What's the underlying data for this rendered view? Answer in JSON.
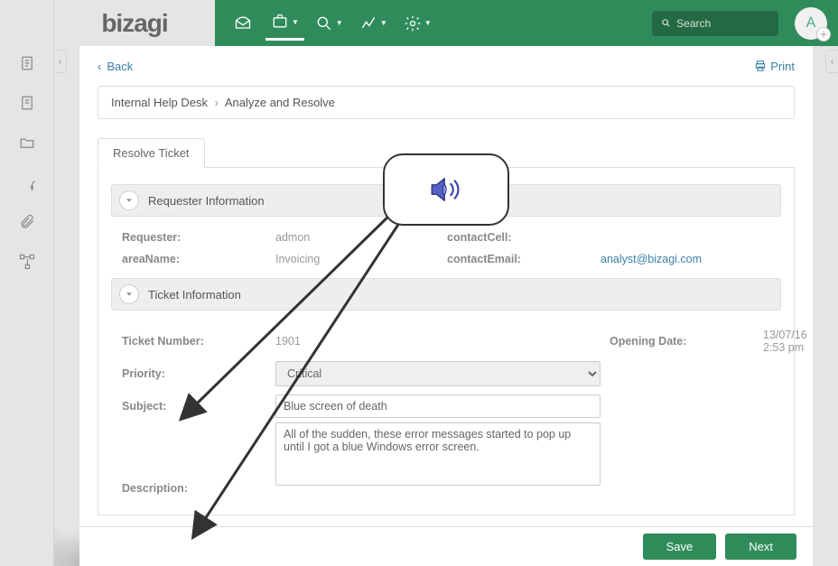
{
  "brand": "bizagi",
  "avatar_initial": "A",
  "search": {
    "placeholder": "Search"
  },
  "subhead": {
    "back": "Back",
    "print": "Print"
  },
  "breadcrumb": {
    "root": "Internal Help Desk",
    "current": "Analyze and Resolve"
  },
  "tab_label": "Resolve Ticket",
  "sections": {
    "requester": {
      "title": "Requester Information",
      "fields": {
        "requester_label": "Requester:",
        "requester_value": "admon",
        "area_label": "areaName:",
        "area_value": "Invoicing",
        "cell_label": "contactCell:",
        "cell_value": "",
        "email_label": "contactEmail:",
        "email_value": "analyst@bizagi.com"
      }
    },
    "ticket": {
      "title": "Ticket Information",
      "fields": {
        "number_label": "Ticket Number:",
        "number_value": "1901",
        "opening_label": "Opening Date:",
        "opening_value": "13/07/16 2:53 pm",
        "priority_label": "Priority:",
        "priority_value": "Critical",
        "subject_label": "Subject:",
        "subject_value": "Blue screen of death",
        "description_label": "Description:",
        "description_value": "All of the sudden, these error messages started to pop up until I got a blue Windows error screen."
      }
    }
  },
  "footer": {
    "save": "Save",
    "next": "Next"
  }
}
